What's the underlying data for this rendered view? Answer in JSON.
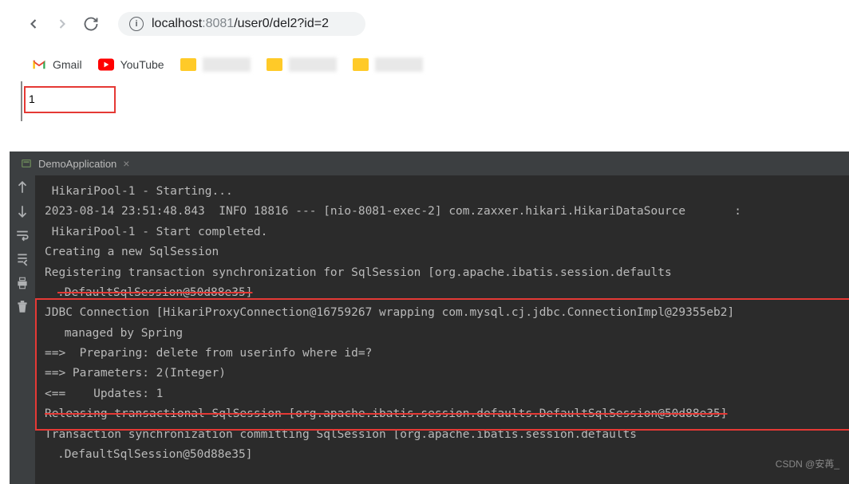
{
  "browser": {
    "url": {
      "host": "localhost",
      "port": ":8081",
      "path": "/user0/del2?id=2"
    },
    "bookmarks": {
      "gmail": "Gmail",
      "youtube": "YouTube"
    },
    "page_result": "1"
  },
  "ide": {
    "tab": {
      "title": "DemoApplication",
      "close": "×"
    },
    "console": {
      "line1": " HikariPool-1 - Starting...",
      "line2": "2023-08-14 23:51:48.843  INFO 18816 --- [nio-8081-exec-2] com.zaxxer.hikari.HikariDataSource       :",
      "line3": " HikariPool-1 - Start completed.",
      "line4": "Creating a new SqlSession",
      "line5": "Registering transaction synchronization for SqlSession [org.apache.ibatis.session.defaults",
      "line5b": ".DefaultSqlSession@50d88e35]",
      "line6": "JDBC Connection [HikariProxyConnection@16759267 wrapping com.mysql.cj.jdbc.ConnectionImpl@29355eb2] ",
      "line6b": " managed by Spring",
      "line7": "==>  Preparing: delete from userinfo where id=?",
      "line8": "==> Parameters: 2(Integer)",
      "line9": "<==    Updates: 1",
      "line10": "Releasing transactional SqlSession [org.apache.ibatis.session.defaults.DefaultSqlSession@50d88e35]",
      "line11": "Transaction synchronization committing SqlSession [org.apache.ibatis.session.defaults",
      "line11b": ".DefaultSqlSession@50d88e35]"
    }
  },
  "watermark": "CSDN @安苒_"
}
